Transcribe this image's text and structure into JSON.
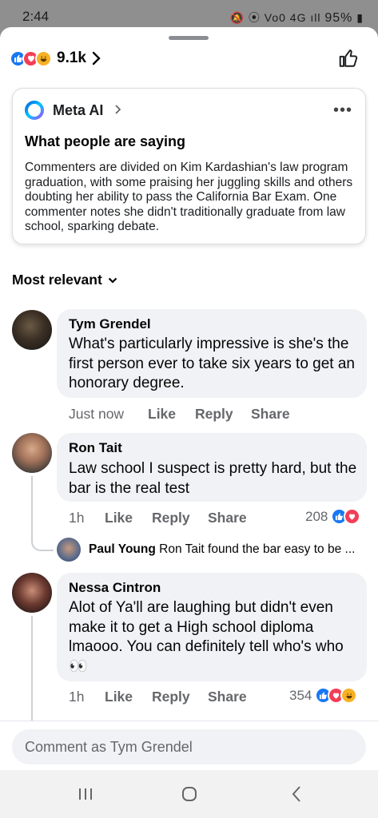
{
  "status_bar": {
    "time": "2:44",
    "icons": "🔕 ⦿ Vo0 4G ıll",
    "battery": "95%"
  },
  "header": {
    "reaction_types": [
      "like",
      "love",
      "haha"
    ],
    "reaction_count": "9.1k"
  },
  "ai_summary": {
    "brand": "Meta AI",
    "heading": "What people are saying",
    "body": "Commenters are divided on Kim Kardashian's law program graduation, with some praising her juggling skills and others doubting her ability to pass the California Bar Exam. One commenter notes she didn't traditionally graduate from law school, sparking debate."
  },
  "sort_label": "Most relevant",
  "comments": [
    {
      "author": "Tym Grendel",
      "text": "What's particularly impressive is she's the first person ever to take six years to get an honorary degree.",
      "time": "Just now",
      "actions": [
        "Like",
        "Reply",
        "Share"
      ]
    },
    {
      "author": "Ron Tait",
      "text": "Law school I suspect is pretty hard, but the bar is the real test",
      "time": "1h",
      "actions": [
        "Like",
        "Reply",
        "Share"
      ],
      "reaction_count": "208",
      "reaction_types": [
        "like",
        "love"
      ],
      "reply_preview": {
        "author": "Paul Young",
        "text": "Ron Tait found the bar easy to be ..."
      }
    },
    {
      "author": "Nessa Cintron",
      "text": "Alot of Ya'll are laughing but didn't even make it to get a High school diploma lmaooo. You can definitely tell who's who👀",
      "time": "1h",
      "actions": [
        "Like",
        "Reply",
        "Share"
      ],
      "reaction_count": "354",
      "reaction_types": [
        "like",
        "love",
        "haha"
      ]
    }
  ],
  "composer": {
    "placeholder": "Comment as Tym Grendel"
  },
  "colors": {
    "fb_blue": "#1877f2",
    "love_red": "#f33e58",
    "haha_yellow": "#f7b125",
    "bubble_gray": "#f0f2f5",
    "meta_text": "#65676b"
  }
}
